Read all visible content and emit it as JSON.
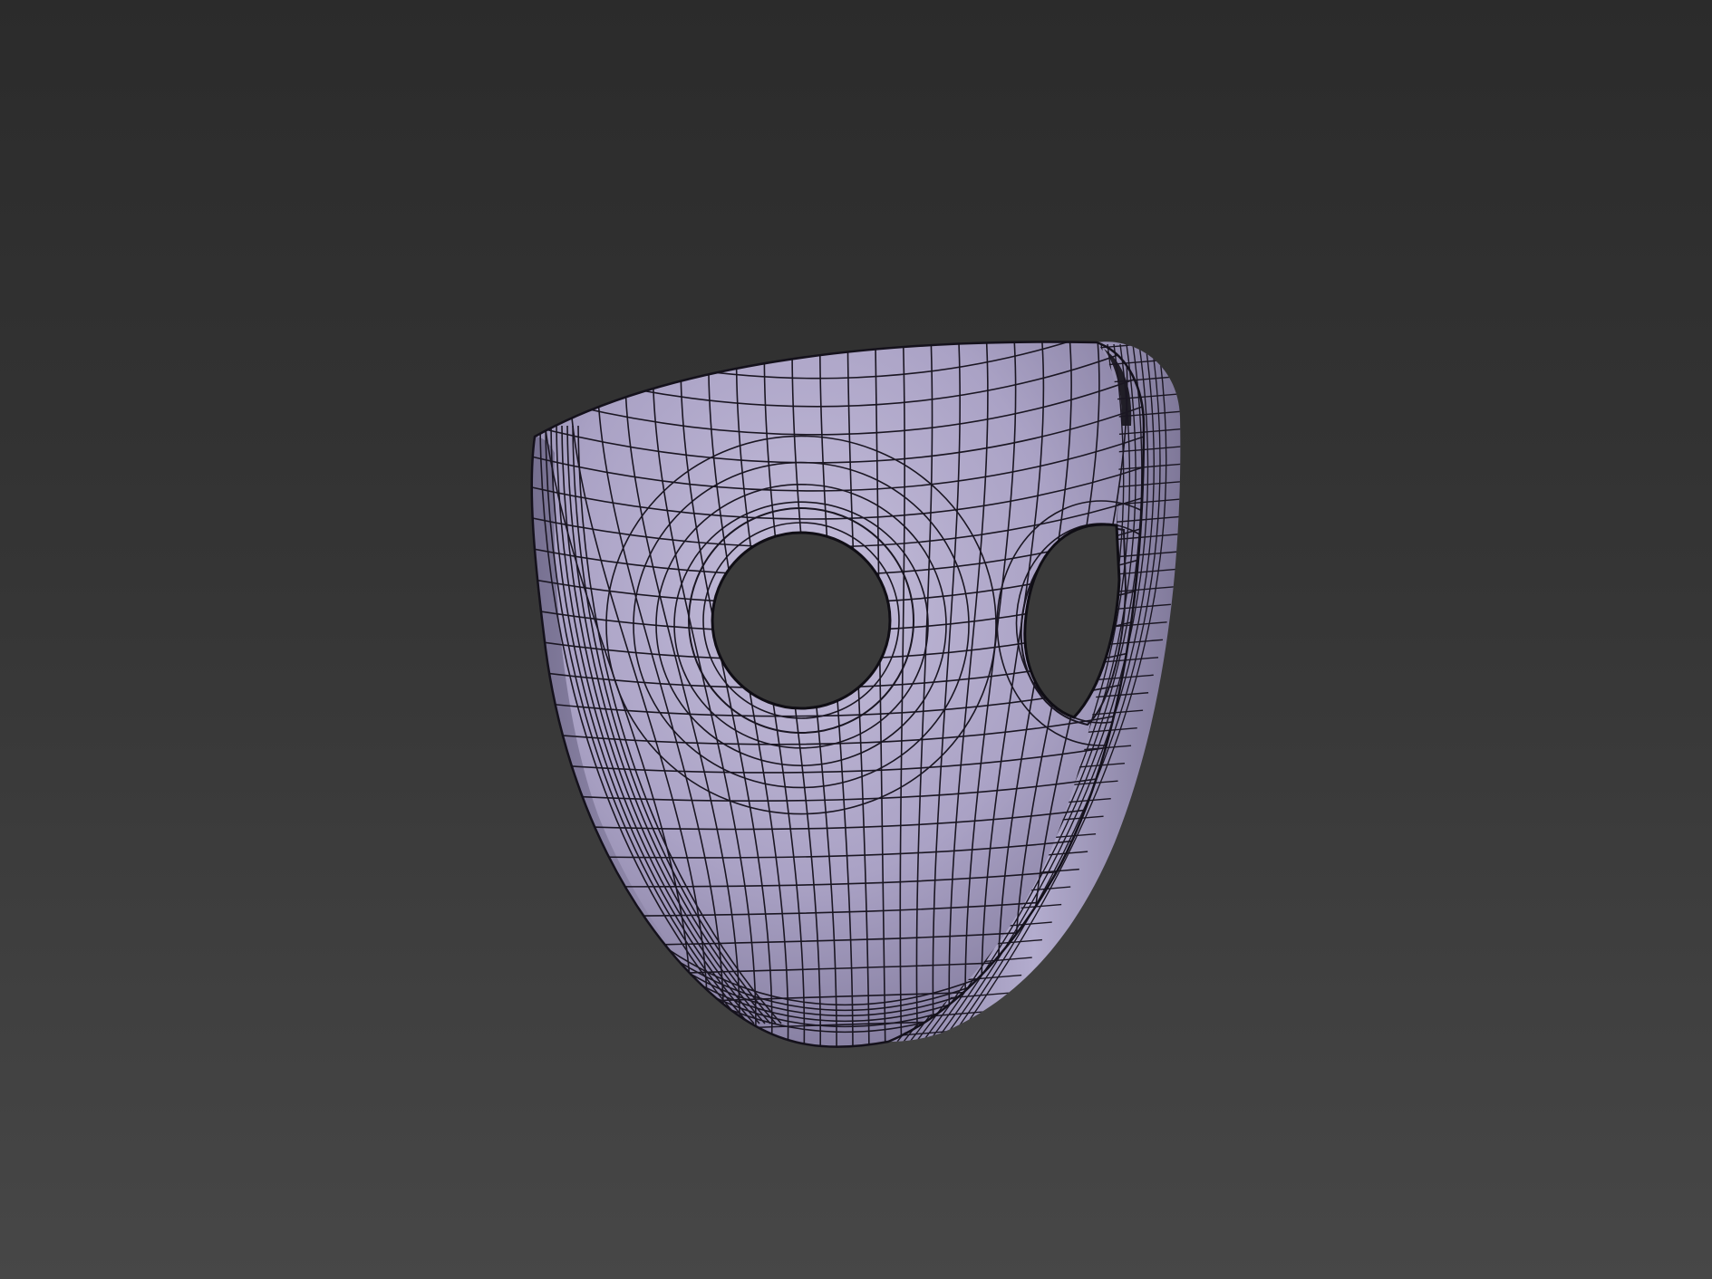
{
  "scene": {
    "object_icon": "wireframe-mask-render",
    "colors": {
      "background_top": "#2b2b2b",
      "background_bottom": "#474747",
      "surface_light": "#c0b9d6",
      "surface_mid": "#a9a1c4",
      "surface_dark": "#7c7597",
      "wire": "#1a1622",
      "hole": "#3a3a3a"
    }
  }
}
